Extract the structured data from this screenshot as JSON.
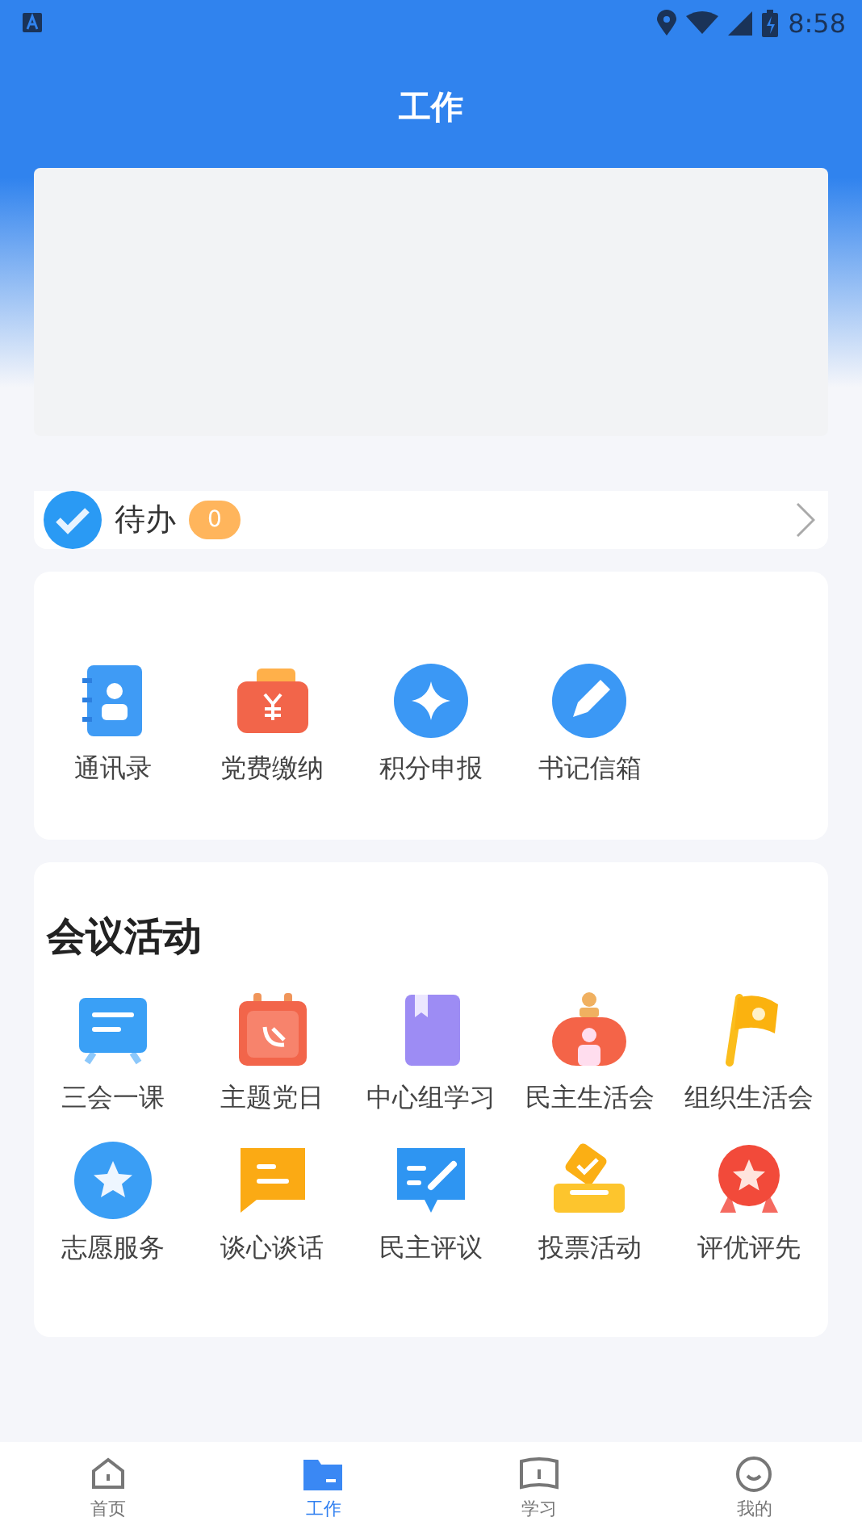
{
  "status_bar": {
    "time": "8:58"
  },
  "header": {
    "title": "工作"
  },
  "todo": {
    "label": "待办",
    "count": "0"
  },
  "tools": [
    {
      "label": "通讯录"
    },
    {
      "label": "党费缴纳"
    },
    {
      "label": "积分申报"
    },
    {
      "label": "书记信箱"
    }
  ],
  "meetings": {
    "title": "会议活动",
    "items": [
      {
        "label": "三会一课"
      },
      {
        "label": "主题党日"
      },
      {
        "label": "中心组学习"
      },
      {
        "label": "民主生活会"
      },
      {
        "label": "组织生活会"
      },
      {
        "label": "志愿服务"
      },
      {
        "label": "谈心谈话"
      },
      {
        "label": "民主评议"
      },
      {
        "label": "投票活动"
      },
      {
        "label": "评优评先"
      }
    ]
  },
  "tab_bar": [
    {
      "label": "首页",
      "selected": false
    },
    {
      "label": "工作",
      "selected": true
    },
    {
      "label": "学习",
      "selected": false
    },
    {
      "label": "我的",
      "selected": false
    }
  ]
}
